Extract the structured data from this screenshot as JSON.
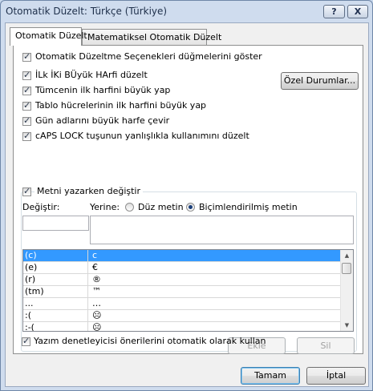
{
  "window": {
    "title": "Otomatik Düzelt: Türkçe (Türkiye)",
    "help_label": "?",
    "close_label": "X"
  },
  "tabs": [
    {
      "label": "Otomatik Düzelt",
      "active": true
    },
    {
      "label": "Matematiksel Otomatik Düzelt",
      "active": false
    }
  ],
  "options": {
    "show_buttons": {
      "label": "Otomatik Düzeltme Seçenekleri düğmelerini göster",
      "checked": true
    },
    "two_caps": {
      "label": "İLk İKi BÜyük HArfi düzelt",
      "checked": true
    },
    "sentence_caps": {
      "label": "Tümcenin ilk harfini büyük yap",
      "checked": true
    },
    "table_caps": {
      "label": "Tablo hücrelerinin ilk harfini büyük yap",
      "checked": true
    },
    "day_names": {
      "label": "Gün adlarını büyük harfe çevir",
      "checked": true
    },
    "caps_lock": {
      "label": "cAPS LOCK tuşunun yanlışlıkla kullanımını düzelt",
      "checked": true
    },
    "exceptions_button": "Özel Durumlar...",
    "replace_typing": {
      "label": "Metni yazarken değiştir",
      "checked": true
    },
    "replace_label": "Değiştir:",
    "with_label": "Yerine:",
    "plain_text": {
      "label": "Düz metin",
      "selected": false
    },
    "formatted_text": {
      "label": "Biçimlendirilmiş metin",
      "selected": true
    },
    "replace_value": "",
    "with_value": "",
    "add_button": "Ekle",
    "delete_button": "Sil",
    "spellcheck": {
      "label": "Yazım denetleyicisi önerilerini otomatik olarak kullan",
      "checked": true
    }
  },
  "replacements": [
    {
      "from": "(c)",
      "to": "c"
    },
    {
      "from": "(e)",
      "to": "€"
    },
    {
      "from": "(r)",
      "to": "®"
    },
    {
      "from": "(tm)",
      "to": "™"
    },
    {
      "from": "...",
      "to": "…"
    },
    {
      "from": ":(",
      "to": "☹"
    },
    {
      "from": ":-(",
      "to": "☹"
    }
  ],
  "selected_row": 0,
  "footer": {
    "ok_button": "Tamam",
    "cancel_button": "İptal"
  }
}
